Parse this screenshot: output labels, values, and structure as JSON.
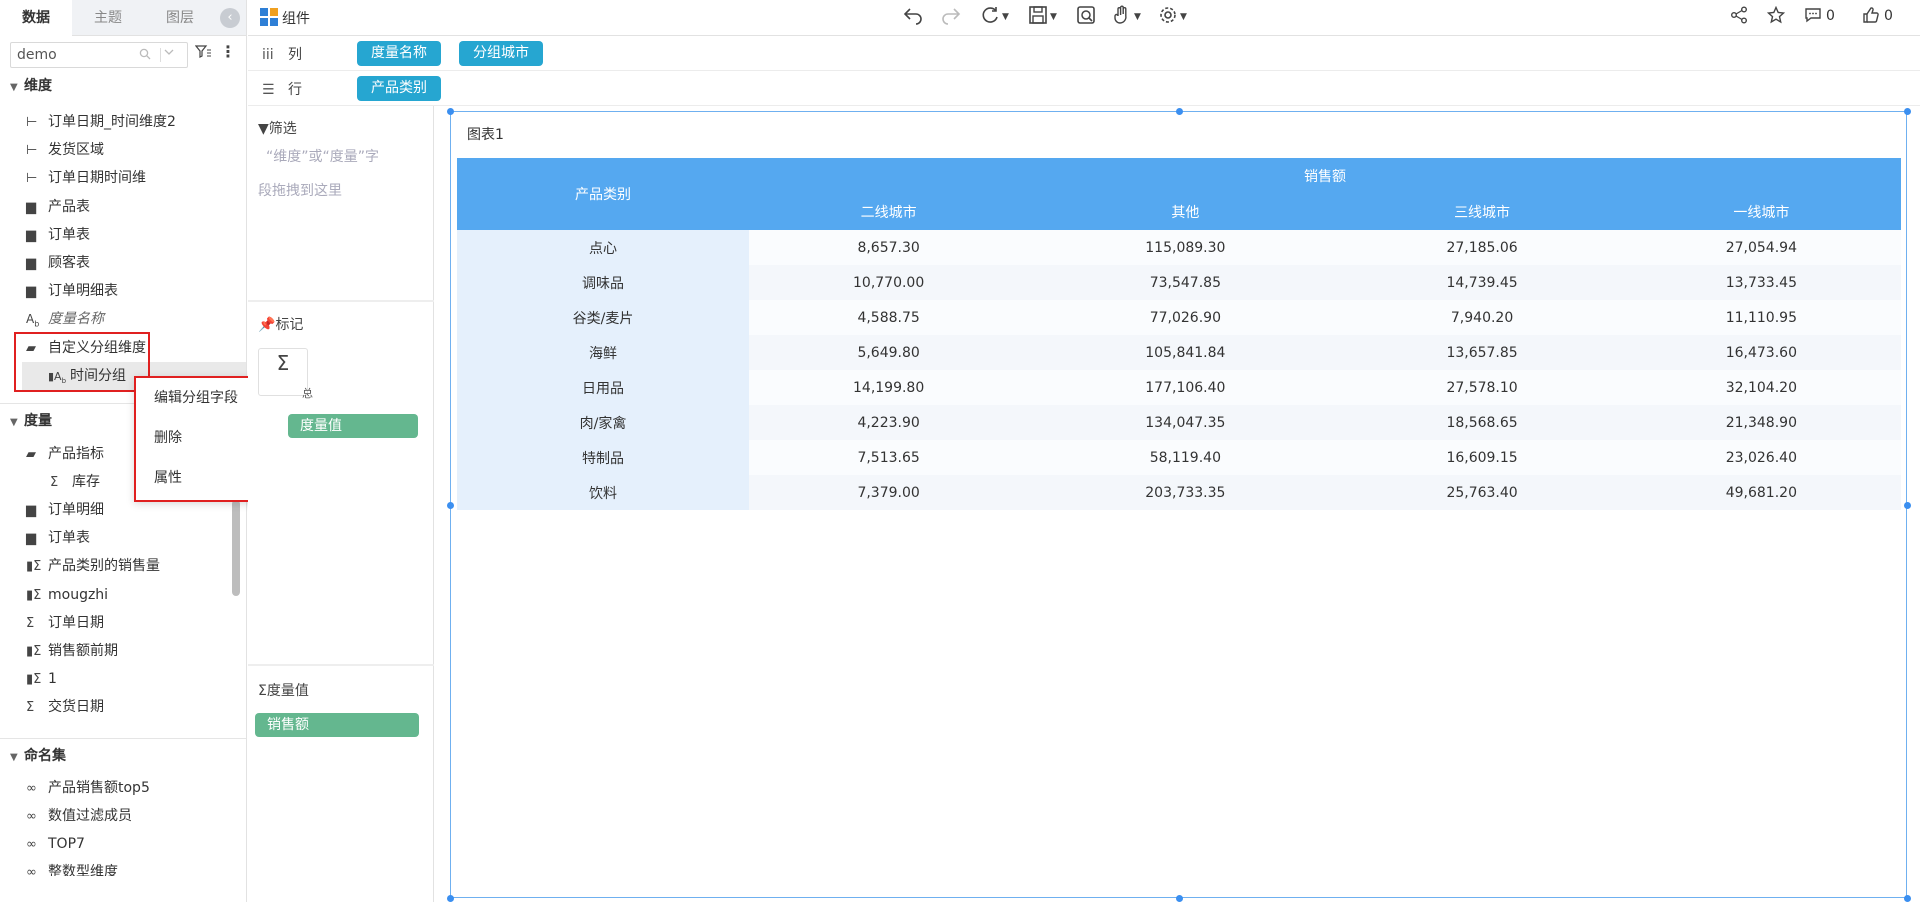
{
  "left_panel": {
    "tabs": [
      "数据",
      "主题",
      "图层"
    ],
    "active_tab": "数据",
    "collapse_icon": "chevron-left-icon",
    "search": {
      "value": "demo",
      "icons": [
        "search-icon",
        "chevron-down-icon"
      ]
    },
    "dimensions": {
      "title": "维度",
      "items": [
        {
          "label": "订单日期_时间维度2",
          "icon": "hierarchy-icon"
        },
        {
          "label": "发货区域",
          "icon": "hierarchy-icon"
        },
        {
          "label": "订单日期时间维",
          "icon": "hierarchy-icon"
        },
        {
          "label": "产品表",
          "icon": "folder-icon"
        },
        {
          "label": "订单表",
          "icon": "folder-icon"
        },
        {
          "label": "顾客表",
          "icon": "folder-icon"
        },
        {
          "label": "订单明细表",
          "icon": "folder-icon"
        },
        {
          "label": "度量名称",
          "icon": "text-field-icon"
        },
        {
          "label": "自定义分组维度",
          "icon": "folder-open-icon"
        },
        {
          "label": "时间分组",
          "icon": "group-field-icon"
        }
      ]
    },
    "measures": {
      "title": "度量",
      "items": [
        {
          "label": "产品指标",
          "icon": "folder-open-icon"
        },
        {
          "label": "库存",
          "icon": "sigma-icon"
        },
        {
          "label": "订单明细",
          "icon": "folder-icon"
        },
        {
          "label": "订单表",
          "icon": "folder-icon"
        },
        {
          "label": "产品类别的销售量",
          "icon": "calc-sigma-icon"
        },
        {
          "label": "mougzhi",
          "icon": "calc-sigma-icon"
        },
        {
          "label": "订单日期",
          "icon": "sigma-icon"
        },
        {
          "label": "销售额前期",
          "icon": "calc-sigma-icon"
        },
        {
          "label": "1",
          "icon": "calc-sigma-icon"
        },
        {
          "label": "交货日期",
          "icon": "sigma-icon"
        }
      ]
    },
    "named_sets": {
      "title": "命名集",
      "items": [
        {
          "label": "产品销售额top5",
          "icon": "set-icon"
        },
        {
          "label": "数值过滤成员",
          "icon": "set-icon"
        },
        {
          "label": "TOP7",
          "icon": "set-icon"
        },
        {
          "label": "整数型维度",
          "icon": "set-icon"
        }
      ]
    }
  },
  "context_menu": {
    "items": [
      "编辑分组字段",
      "删除",
      "属性"
    ]
  },
  "toolbar": {
    "component_label": "组件",
    "comment_count": "0",
    "like_count": "0",
    "icons": [
      "undo-icon",
      "redo-icon",
      "refresh-icon",
      "save-icon",
      "preview-icon",
      "hand-icon",
      "settings-icon",
      "share-icon",
      "star-icon",
      "comment-icon",
      "like-icon"
    ]
  },
  "shelves": {
    "columns": {
      "label": "列",
      "pills": [
        "度量名称",
        "分组城市"
      ]
    },
    "rows": {
      "label": "行",
      "pills": [
        "产品类别"
      ]
    }
  },
  "mid_panel": {
    "filter_title": "筛选",
    "filter_hint_1": "“维度”或“度量”字",
    "filter_hint_2": "段拖拽到这里",
    "marks_title": "标记",
    "marks_box_label": "Σ",
    "marks_box_sub": "总",
    "marks_pill": "度量值",
    "measure_values_title": "度量值",
    "measure_values_pill": "销售额"
  },
  "chart": {
    "title": "图表1",
    "header_color": "#55a8f0",
    "row_header_color": "#e5f0fc",
    "table": {
      "row_dim_label": "产品类别",
      "measure_label": "销售额",
      "columns": [
        "二线城市",
        "其他",
        "三线城市",
        "一线城市"
      ],
      "rows": [
        {
          "category": "点心",
          "values": [
            "8,657.30",
            "115,089.30",
            "27,185.06",
            "27,054.94"
          ]
        },
        {
          "category": "调味品",
          "values": [
            "10,770.00",
            "73,547.85",
            "14,739.45",
            "13,733.45"
          ]
        },
        {
          "category": "谷类/麦片",
          "values": [
            "4,588.75",
            "77,026.90",
            "7,940.20",
            "11,110.95"
          ]
        },
        {
          "category": "海鲜",
          "values": [
            "5,649.80",
            "105,841.84",
            "13,657.85",
            "16,473.60"
          ]
        },
        {
          "category": "日用品",
          "values": [
            "14,199.80",
            "177,106.40",
            "27,578.10",
            "32,104.20"
          ]
        },
        {
          "category": "肉/家禽",
          "values": [
            "4,223.90",
            "134,047.35",
            "18,568.65",
            "21,348.90"
          ]
        },
        {
          "category": "特制品",
          "values": [
            "7,513.65",
            "58,119.40",
            "16,609.15",
            "23,026.40"
          ]
        },
        {
          "category": "饮料",
          "values": [
            "7,379.00",
            "203,733.35",
            "25,763.40",
            "49,681.20"
          ]
        }
      ]
    }
  }
}
